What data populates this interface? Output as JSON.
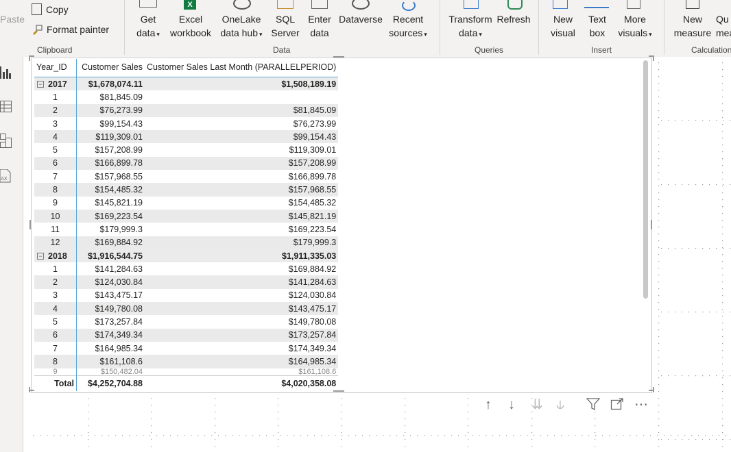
{
  "ribbon": {
    "clipboard": {
      "paste": "Paste",
      "copy": "Copy",
      "format_painter": "Format painter",
      "label": "Clipboard"
    },
    "data": {
      "get_data": [
        "Get",
        "data"
      ],
      "excel": [
        "Excel",
        "workbook"
      ],
      "onelake": [
        "OneLake",
        "data hub"
      ],
      "sql": [
        "SQL",
        "Server"
      ],
      "enter": [
        "Enter",
        "data"
      ],
      "dataverse": "Dataverse",
      "recent": [
        "Recent",
        "sources"
      ],
      "label": "Data"
    },
    "queries": {
      "transform": [
        "Transform",
        "data"
      ],
      "refresh": "Refresh",
      "label": "Queries"
    },
    "insert": {
      "new_visual": [
        "New",
        "visual"
      ],
      "text_box": [
        "Text",
        "box"
      ],
      "more_visuals": [
        "More",
        "visuals"
      ],
      "label": "Insert"
    },
    "calc": {
      "new_measure": [
        "New",
        "measure"
      ],
      "quick": [
        "Qu",
        "mea"
      ],
      "label": "Calculation"
    }
  },
  "matrix": {
    "headers": [
      "Year_ID",
      "Customer Sales",
      "Customer Sales Last Month (PARALLELPERIOD)"
    ],
    "rows": [
      {
        "type": "year",
        "c0": "2017",
        "c1": "$1,678,074.11",
        "c2": "$1,508,189.19"
      },
      {
        "type": "month",
        "c0": "1",
        "c1": "$81,845.09",
        "c2": ""
      },
      {
        "type": "month",
        "c0": "2",
        "c1": "$76,273.99",
        "c2": "$81,845.09"
      },
      {
        "type": "month",
        "c0": "3",
        "c1": "$99,154.43",
        "c2": "$76,273.99"
      },
      {
        "type": "month",
        "c0": "4",
        "c1": "$119,309.01",
        "c2": "$99,154.43"
      },
      {
        "type": "month",
        "c0": "5",
        "c1": "$157,208.99",
        "c2": "$119,309.01"
      },
      {
        "type": "month",
        "c0": "6",
        "c1": "$166,899.78",
        "c2": "$157,208.99"
      },
      {
        "type": "month",
        "c0": "7",
        "c1": "$157,968.55",
        "c2": "$166,899.78"
      },
      {
        "type": "month",
        "c0": "8",
        "c1": "$154,485.32",
        "c2": "$157,968.55"
      },
      {
        "type": "month",
        "c0": "9",
        "c1": "$145,821.19",
        "c2": "$154,485.32"
      },
      {
        "type": "month",
        "c0": "10",
        "c1": "$169,223.54",
        "c2": "$145,821.19"
      },
      {
        "type": "month",
        "c0": "11",
        "c1": "$179,999.3",
        "c2": "$169,223.54"
      },
      {
        "type": "month",
        "c0": "12",
        "c1": "$169,884.92",
        "c2": "$179,999.3"
      },
      {
        "type": "year",
        "c0": "2018",
        "c1": "$1,916,544.75",
        "c2": "$1,911,335.03"
      },
      {
        "type": "month",
        "c0": "1",
        "c1": "$141,284.63",
        "c2": "$169,884.92"
      },
      {
        "type": "month",
        "c0": "2",
        "c1": "$124,030.84",
        "c2": "$141,284.63"
      },
      {
        "type": "month",
        "c0": "3",
        "c1": "$143,475.17",
        "c2": "$124,030.84"
      },
      {
        "type": "month",
        "c0": "4",
        "c1": "$149,780.08",
        "c2": "$143,475.17"
      },
      {
        "type": "month",
        "c0": "5",
        "c1": "$173,257.84",
        "c2": "$149,780.08"
      },
      {
        "type": "month",
        "c0": "6",
        "c1": "$174,349.34",
        "c2": "$173,257.84"
      },
      {
        "type": "month",
        "c0": "7",
        "c1": "$164,985.34",
        "c2": "$174,349.34"
      },
      {
        "type": "month",
        "c0": "8",
        "c1": "$161,108.6",
        "c2": "$164,985.34"
      }
    ],
    "partial_row": {
      "c0": "9",
      "c1": "$150,482.04",
      "c2": "$161,108.6"
    },
    "total": {
      "c0": "Total",
      "c1": "$4,252,704.88",
      "c2": "$4,020,358.08"
    }
  },
  "colors": {
    "accent": "#5aa7d6",
    "excel_green": "#107c41",
    "ribbon_bg": "#f3f2f1"
  }
}
